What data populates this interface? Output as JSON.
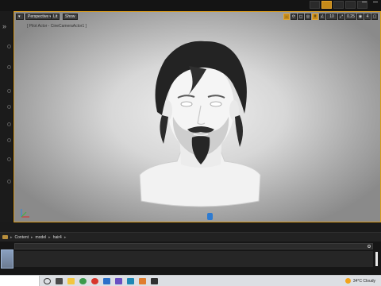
{
  "viewport": {
    "perspective_label": "Perspective",
    "lit_label": "Lit",
    "show_label": "Show",
    "pilot_label": "[ Pilot Actor - CineCameraActor1 ]",
    "snap_angle": "10",
    "snap_scale": "0.25",
    "camera_speed": "4"
  },
  "content_browser": {
    "path": [
      "Content",
      "model",
      "hair4"
    ]
  },
  "taskbar": {
    "weather": "34°C Cloudy",
    "time": ""
  },
  "colors": {
    "accent": "#c58a19",
    "viewport_border": "#d69a1f",
    "camera_marker": "#2e7bd1"
  },
  "icons": {
    "expand": "chevron-right-icon",
    "search": "search-icon",
    "folder": "folder-icon",
    "weather": "sun-icon",
    "axis": "axis-gizmo-icon"
  }
}
